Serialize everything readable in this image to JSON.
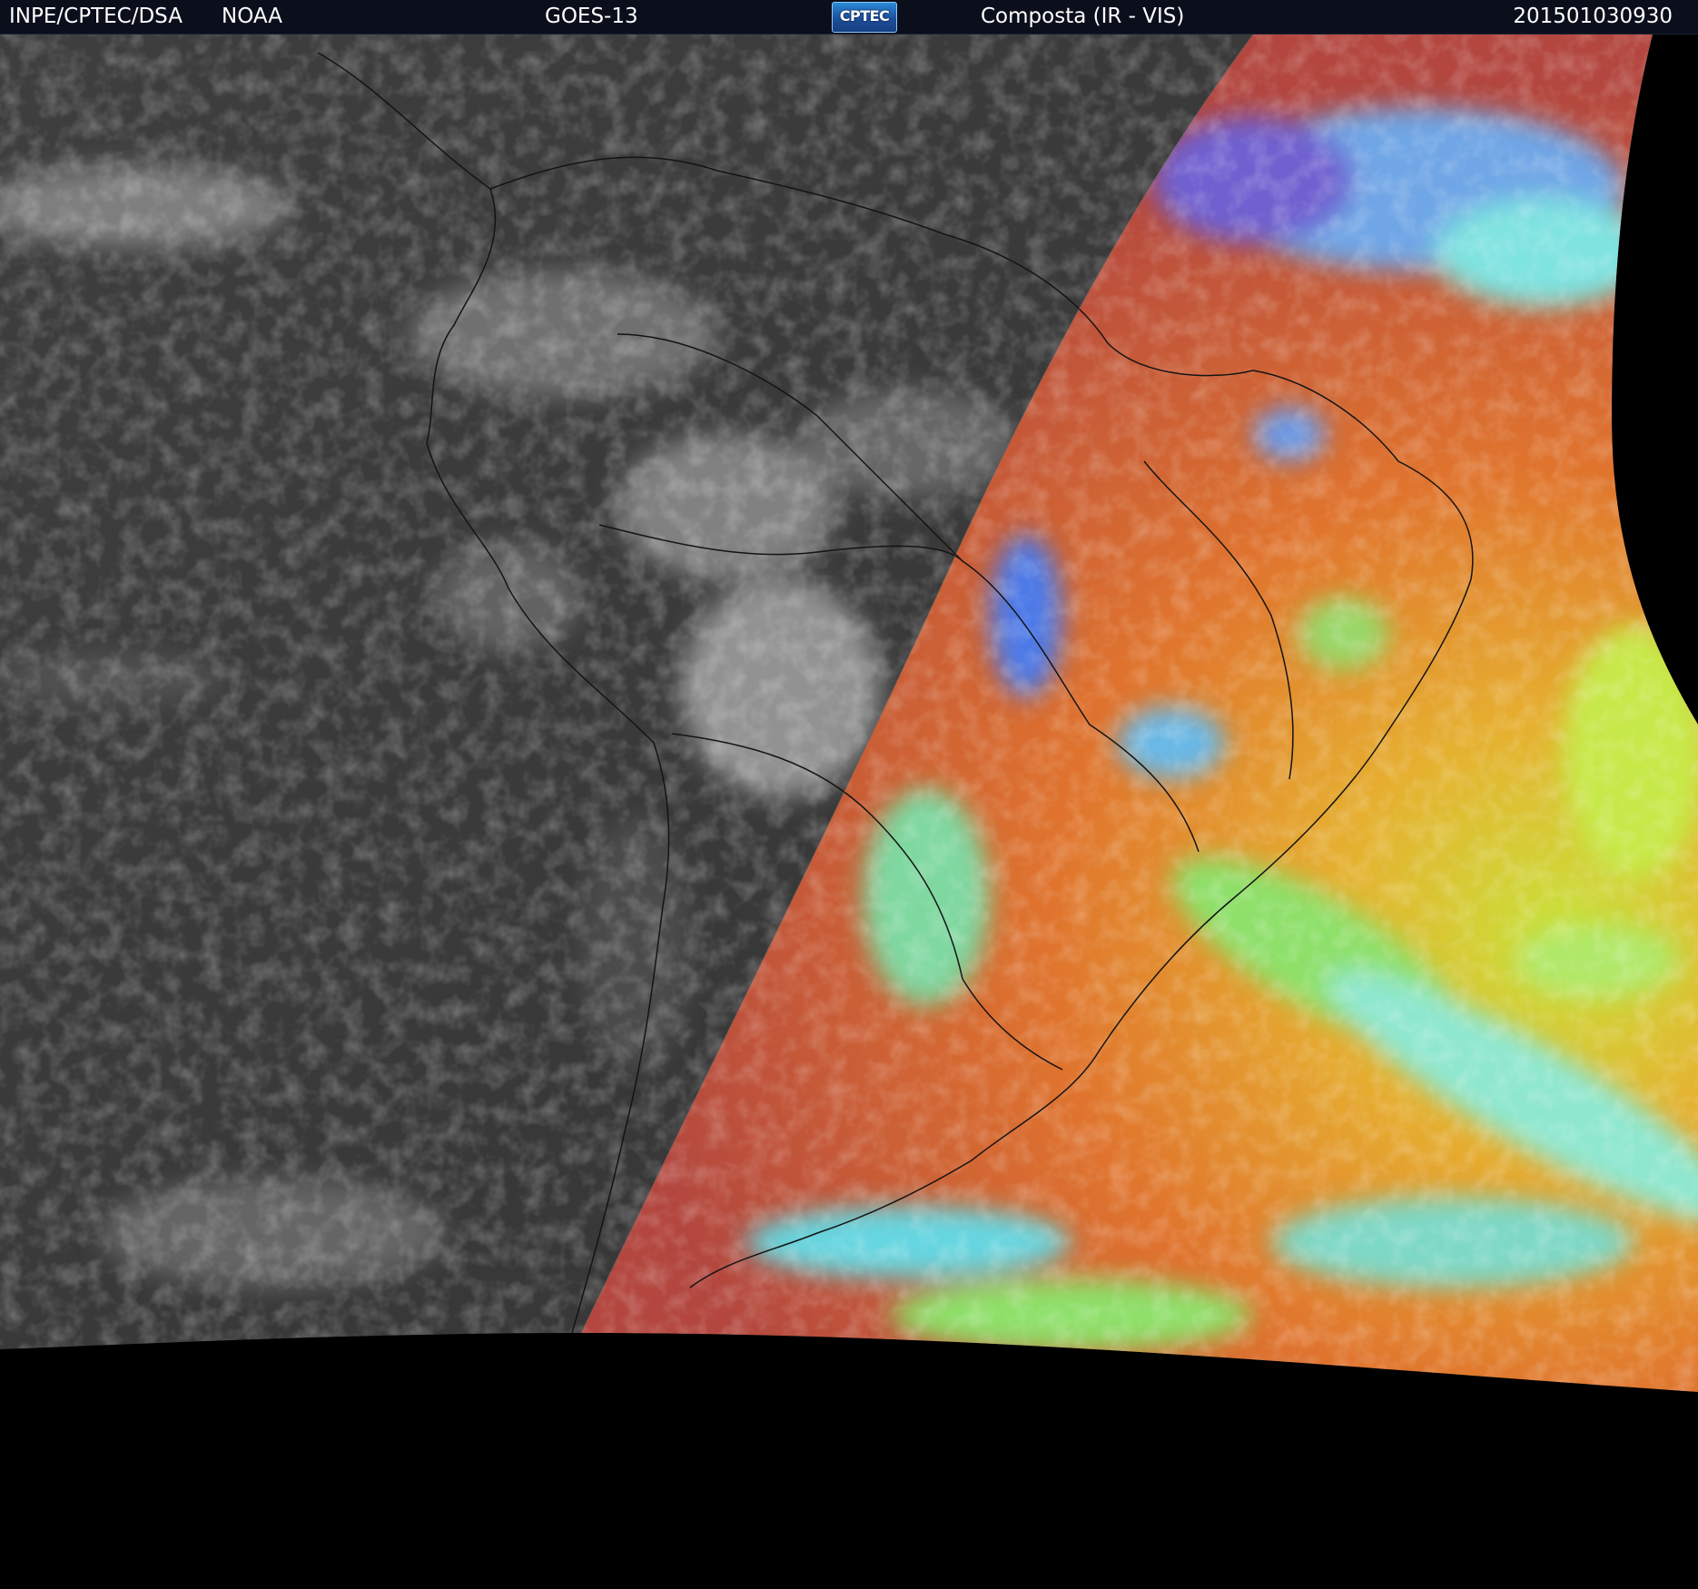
{
  "header": {
    "org": "INPE/CPTEC/DSA",
    "agency": "NOAA",
    "satellite": "GOES-13",
    "logo_text": "CPTEC",
    "product": "Composta (IR - VIS)",
    "timestamp": "201501030930"
  },
  "colors": {
    "header_bg": "#0b0f1c",
    "night_side": "#3b3b3b",
    "day_side_warm": "#b6483f",
    "day_side_orange": "#e8802a",
    "day_side_yellow": "#c9e23a",
    "cloud_cyan": "#6fe0d8",
    "cloud_green": "#8ee06a",
    "cloud_blue": "#4d7ae8",
    "space": "#000000"
  },
  "icons": {
    "logo": "cptec-logo-icon"
  }
}
